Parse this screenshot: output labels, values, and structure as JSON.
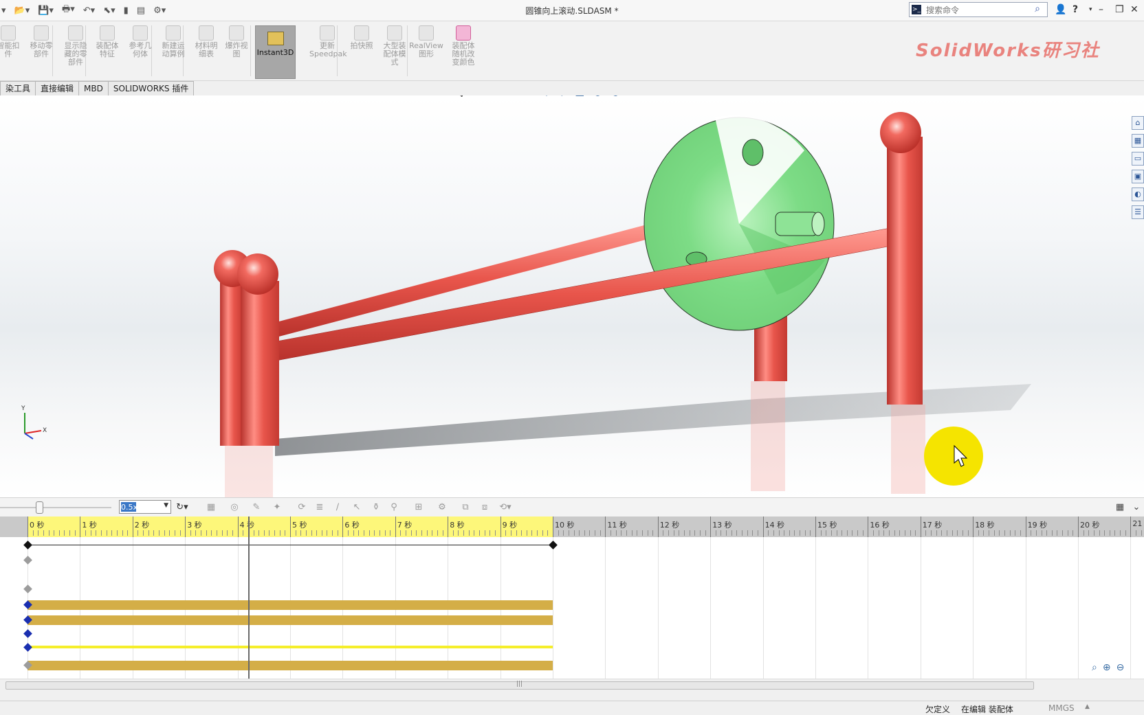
{
  "window": {
    "title": "圆锥向上滚动.SLDASM *",
    "search_placeholder": "搜索命令",
    "help_label": "?"
  },
  "ribbon": {
    "watermark": "SolidWorks研习社",
    "buttons": [
      {
        "label": "智能扣\n件",
        "icon": "smart-fastener-icon"
      },
      {
        "label": "移动零\n部件",
        "icon": "move-component-icon"
      },
      {
        "label": "显示隐\n藏的零\n部件",
        "icon": "show-hidden-icon"
      },
      {
        "label": "装配体\n特征",
        "icon": "assembly-feature-icon"
      },
      {
        "label": "参考几\n何体",
        "icon": "reference-geometry-icon"
      },
      {
        "label": "新建运\n动算例",
        "icon": "new-motion-study-icon"
      },
      {
        "label": "材料明\n细表",
        "icon": "bom-icon"
      },
      {
        "label": "爆炸视\n图",
        "icon": "exploded-view-icon"
      },
      {
        "label": "Instant3D",
        "icon": "instant3d-icon"
      },
      {
        "label": "更新\nSpeedpak",
        "icon": "speedpak-icon"
      },
      {
        "label": "拍快照",
        "icon": "snapshot-icon"
      },
      {
        "label": "大型装\n配体模\n式",
        "icon": "large-assembly-icon"
      },
      {
        "label": "RealView\n图形",
        "icon": "realview-icon"
      },
      {
        "label": "装配体\n随机改\n变颜色",
        "icon": "random-color-icon"
      }
    ]
  },
  "tabs": [
    "染工具",
    "直接编辑",
    "MBD",
    "SOLIDWORKS 插件"
  ],
  "motion": {
    "speed_value": "0.5x",
    "time_labels": [
      "0 秒",
      "1 秒",
      "2 秒",
      "3 秒",
      "4 秒",
      "5 秒",
      "6 秒",
      "7 秒",
      "8 秒",
      "9 秒",
      "10 秒",
      "11 秒",
      "12 秒",
      "13 秒",
      "14 秒",
      "15 秒",
      "16 秒",
      "17 秒",
      "18 秒",
      "19 秒",
      "20 秒",
      "21"
    ],
    "study_length_seconds": 10,
    "current_time_seconds": 4.2
  },
  "status": {
    "definition": "欠定义",
    "mode": "在编辑 装配体",
    "units": "MMGS"
  },
  "colors": {
    "rod": "#e8554b",
    "cone": "#7ddc86",
    "timeline_active": "#fdf77a",
    "track_bar": "#d4ae47",
    "cursor_highlight": "#f5e400"
  }
}
